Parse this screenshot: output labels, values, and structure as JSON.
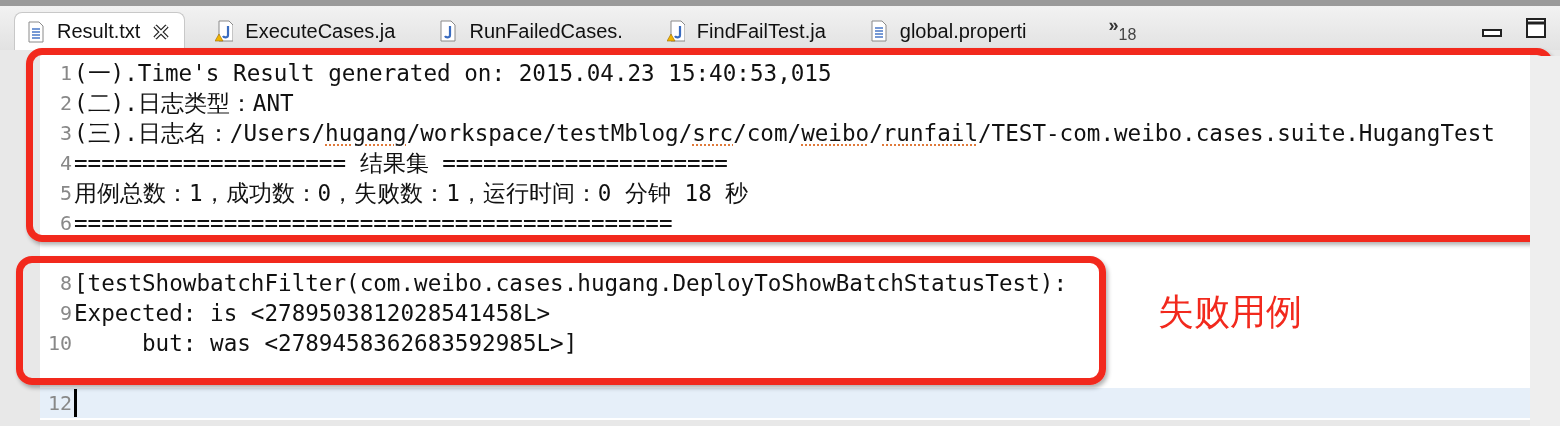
{
  "tabs": [
    {
      "label": "Result.txt",
      "kind": "text",
      "selected": true,
      "closable": true
    },
    {
      "label": "ExecuteCases.ja",
      "kind": "java-warning",
      "selected": false,
      "closable": false
    },
    {
      "label": "RunFailedCases.",
      "kind": "java",
      "selected": false,
      "closable": false
    },
    {
      "label": "FindFailTest.ja",
      "kind": "java-warning",
      "selected": false,
      "closable": false
    },
    {
      "label": "global.properti",
      "kind": "text",
      "selected": false,
      "closable": false
    }
  ],
  "overflow": {
    "mark": "»",
    "count": "18"
  },
  "editor": {
    "lines": [
      {
        "number": "1",
        "text": "(一).Time's Result generated on: 2015.04.23 15:40:53,015",
        "current": false
      },
      {
        "number": "2",
        "text": "(二).日志类型：ANT",
        "current": false
      },
      {
        "number": "3",
        "segments": [
          {
            "text": "(三).日志名：/Users/",
            "misspelled": false
          },
          {
            "text": "hugang",
            "misspelled": true
          },
          {
            "text": "/workspace/testMblog/",
            "misspelled": false
          },
          {
            "text": "src",
            "misspelled": true
          },
          {
            "text": "/com/",
            "misspelled": false
          },
          {
            "text": "weibo",
            "misspelled": true
          },
          {
            "text": "/",
            "misspelled": false
          },
          {
            "text": "runfail",
            "misspelled": true
          },
          {
            "text": "/TEST-com.weibo.cases.suite.HugangTest",
            "misspelled": false
          }
        ],
        "current": false
      },
      {
        "number": "4",
        "text": "==================== 结果集 =====================",
        "current": false
      },
      {
        "number": "5",
        "text": "用例总数：1，成功数：0，失败数：1，运行时间：0 分钟 18 秒",
        "current": false
      },
      {
        "number": "6",
        "text": "============================================",
        "current": false
      },
      {
        "current": false
      },
      {
        "number": "8",
        "text": "[testShowbatchFilter(com.weibo.cases.hugang.DeployToShowBatchStatusTest):",
        "current": false
      },
      {
        "number": "9",
        "text": "Expected: is <2789503812028541458L>",
        "current": false
      },
      {
        "number": "10",
        "text": "     but: was <2789458362683592985L>]",
        "current": false
      },
      {
        "current": false
      },
      {
        "number": "12",
        "current": true
      }
    ]
  },
  "annotation": {
    "label": "失败用例"
  }
}
